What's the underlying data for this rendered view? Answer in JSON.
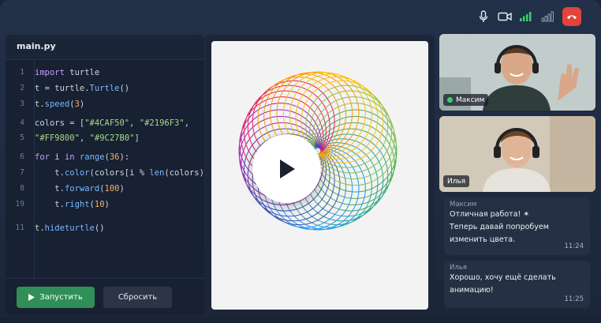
{
  "editor": {
    "filename": "main.py",
    "lines": [
      {
        "n": "1",
        "tokens": [
          {
            "t": "import",
            "c": "kw"
          },
          {
            "t": " turtle",
            "c": "pl"
          }
        ]
      },
      {
        "n": "2",
        "tokens": [
          {
            "t": "t = turtle.",
            "c": "pl"
          },
          {
            "t": "Turtle",
            "c": "fn"
          },
          {
            "t": "()",
            "c": "pl"
          }
        ]
      },
      {
        "n": "3",
        "tokens": [
          {
            "t": "t.",
            "c": "pl"
          },
          {
            "t": "speed",
            "c": "fn"
          },
          {
            "t": "(",
            "c": "pl"
          },
          {
            "t": "3",
            "c": "num"
          },
          {
            "t": ")",
            "c": "pl"
          }
        ]
      },
      {
        "n": "4",
        "tokens": [
          {
            "t": "colors = [",
            "c": "pl"
          },
          {
            "t": "\"#4CAF50\"",
            "c": "str"
          },
          {
            "t": ", ",
            "c": "pl"
          },
          {
            "t": "\"#2196F3\"",
            "c": "str"
          },
          {
            "t": ",",
            "c": "pl"
          }
        ]
      },
      {
        "n": "5",
        "tokens": [
          {
            "t": "\"#FF9800\"",
            "c": "str"
          },
          {
            "t": ", ",
            "c": "pl"
          },
          {
            "t": "\"#9C27B0\"",
            "c": "str"
          },
          {
            "t": "]",
            "c": "pl"
          }
        ]
      },
      {
        "n": "6",
        "tokens": [
          {
            "t": "for",
            "c": "kw"
          },
          {
            "t": " i ",
            "c": "pl"
          },
          {
            "t": "in",
            "c": "kw"
          },
          {
            "t": " ",
            "c": "pl"
          },
          {
            "t": "range",
            "c": "fn"
          },
          {
            "t": "(",
            "c": "pl"
          },
          {
            "t": "36",
            "c": "num"
          },
          {
            "t": "):",
            "c": "pl"
          }
        ]
      },
      {
        "n": "7",
        "tokens": [
          {
            "t": "    t.",
            "c": "pl"
          },
          {
            "t": "color",
            "c": "fn"
          },
          {
            "t": "(colors[i % ",
            "c": "pl"
          },
          {
            "t": "len",
            "c": "fn"
          },
          {
            "t": "(colors)])",
            "c": "pl"
          }
        ]
      },
      {
        "n": "8",
        "tokens": [
          {
            "t": "    t.",
            "c": "pl"
          },
          {
            "t": "forward",
            "c": "fn"
          },
          {
            "t": "(",
            "c": "pl"
          },
          {
            "t": "100",
            "c": "num"
          },
          {
            "t": ")",
            "c": "pl"
          }
        ]
      },
      {
        "n": "19",
        "tokens": [
          {
            "t": "    t.",
            "c": "pl"
          },
          {
            "t": "right",
            "c": "fn"
          },
          {
            "t": "(",
            "c": "pl"
          },
          {
            "t": "10",
            "c": "num"
          },
          {
            "t": ")",
            "c": "pl"
          }
        ]
      },
      {
        "n": "11",
        "tokens": [
          {
            "t": "t.",
            "c": "pl"
          },
          {
            "t": "hideturtle",
            "c": "fn"
          },
          {
            "t": "()",
            "c": "pl"
          }
        ]
      }
    ],
    "run_label": "Запустить",
    "reset_label": "Сбросить"
  },
  "video": {
    "participant_1": "Максим",
    "participant_2": "Илья"
  },
  "chat": {
    "messages": [
      {
        "author": "Максим",
        "line1": "Отличная работа! ✴",
        "line2": "Теперь давай попробуем",
        "line3": "изменить цвета.",
        "time": "11:24"
      },
      {
        "author": "Илья",
        "line1": "Хорошо, хочу ещё сделать",
        "line2": "анимацию!",
        "time": "11:25"
      }
    ]
  },
  "colors": {
    "accent_green": "#2f8f56",
    "end_call": "#e0443a",
    "spiro": [
      "#4CAF50",
      "#2196F3",
      "#FF9800",
      "#9C27B0"
    ]
  }
}
